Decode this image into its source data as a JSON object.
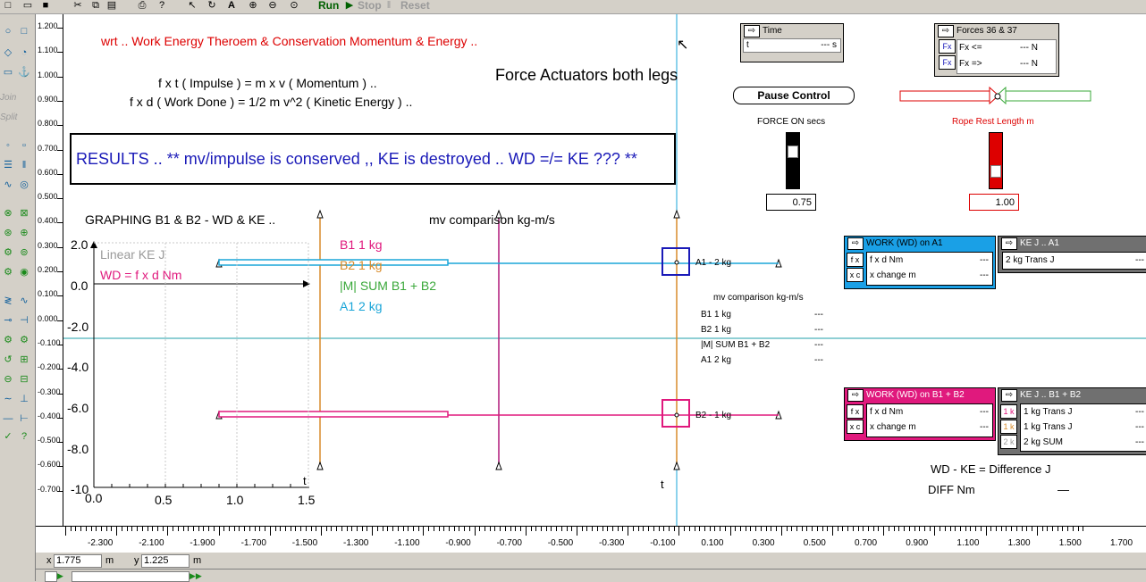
{
  "toolbar": {
    "run": "Run",
    "stop": "Stop",
    "reset": "Reset"
  },
  "palette": {
    "join": "Join",
    "split": "Split"
  },
  "yruler": [
    "1.200",
    "1.100",
    "1.000",
    "0.900",
    "0.800",
    "0.700",
    "0.600",
    "0.500",
    "0.400",
    "0.300",
    "0.200",
    "0.100",
    "0.000",
    "-0.100",
    "-0.200",
    "-0.300",
    "-0.400",
    "-0.500",
    "-0.600",
    "-0.700"
  ],
  "xruler": [
    "-2.300",
    "-2.100",
    "-1.900",
    "-1.700",
    "-1.500",
    "-1.300",
    "-1.100",
    "-0.900",
    "-0.700",
    "-0.500",
    "-0.300",
    "-0.100",
    "0.100",
    "0.300",
    "0.500",
    "0.700",
    "0.900",
    "1.100",
    "1.300",
    "1.500",
    "1.700"
  ],
  "text": {
    "wrt": "wrt .. Work Energy Theroem & Conservation Momentum & Energy ..",
    "impulse": "f x t  ( Impulse )  =  m x v  ( Momentum )  ..",
    "workdone": "f x d  ( Work Done )  =  1/2 m v^2  ( Kinetic Energy )  ..",
    "title": "Force Actuators both legs",
    "results": "RESULTS .. ** mv/impulse is conserved ,, KE is destroyed .. WD =/= KE ??? **",
    "graphing": "GRAPHING B1 & B2 - WD & KE ..",
    "mv_comparison": "mv comparison kg-m/s",
    "t1": "t",
    "t2": "t",
    "a1_label": "A1 - 2 kg",
    "b2_label": "B2 - 1 kg",
    "wd_ke": "WD - KE  =  Difference  J",
    "diff": "DIFF Nm",
    "diff_value": "—"
  },
  "graph": {
    "y_ticks": [
      "2.0",
      "0.0",
      "-2.0",
      "-4.0",
      "-6.0",
      "-8.0",
      "-10"
    ],
    "x_ticks": [
      "0.0",
      "0.5",
      "1.0",
      "1.5"
    ],
    "legend_ke": "Linear KE J",
    "legend_wd": "WD = f x d Nm"
  },
  "legend": {
    "b1": "B1 1 kg",
    "b2": "B2 1 kg",
    "sum": "|M| SUM B1 + B2",
    "a1": "A1 2 kg"
  },
  "mvtable": {
    "title": "mv comparison kg-m/s",
    "rows": [
      {
        "label": "B1 1 kg",
        "value": "---"
      },
      {
        "label": "B2 1 kg",
        "value": "---"
      },
      {
        "label": "|M| SUM B1 + B2",
        "value": "---"
      },
      {
        "label": "A1 2 kg",
        "value": "---"
      }
    ]
  },
  "time_panel": {
    "title": "Time",
    "label": "t",
    "value": "--- s"
  },
  "forces_panel": {
    "title": "Forces 36 & 37",
    "rows": [
      {
        "btn": "Fx",
        "label": "Fx <=",
        "value": "--- N"
      },
      {
        "btn": "Fx",
        "label": "Fx =>",
        "value": "--- N"
      }
    ]
  },
  "pause_button": "Pause Control",
  "force_on": {
    "label": "FORCE ON secs",
    "value": "0.75"
  },
  "rope_rest": {
    "label": "Rope Rest Length m",
    "value": "1.00"
  },
  "wd_a1": {
    "title": "WORK (WD) on A1",
    "rows": [
      {
        "btn": "f x",
        "label": "f x d Nm",
        "value": "---"
      },
      {
        "btn": "x c",
        "label": "x change m",
        "value": "---"
      }
    ]
  },
  "ke_a1": {
    "title": "KE J .. A1",
    "rows": [
      {
        "label": "2 kg Trans J",
        "value": "---"
      }
    ]
  },
  "wd_b": {
    "title": "WORK (WD) on B1 + B2",
    "rows": [
      {
        "btn": "f x",
        "label": "f x d Nm",
        "value": "---"
      },
      {
        "btn": "x c",
        "label": "x change m",
        "value": "---"
      }
    ]
  },
  "ke_b": {
    "title": "KE J .. B1 + B2",
    "rows": [
      {
        "btn": "1 k",
        "label": "1 kg Trans J",
        "value": "---"
      },
      {
        "btn": "1 k",
        "label": "1 kg Trans J",
        "value": "---"
      },
      {
        "btn": "2 k",
        "label": "2 kg SUM",
        "value": "---"
      }
    ]
  },
  "status": {
    "x_label": "x",
    "x_value": "1.775",
    "x_unit": "m",
    "y_label": "y",
    "y_value": "1.225",
    "y_unit": "m"
  },
  "colors": {
    "red": "#dd0000",
    "blue": "#1a1ab8",
    "magenta": "#e0197d",
    "orange": "#d98c2b",
    "cyan": "#1aa5d8",
    "green": "#3aa83a",
    "teal": "#1f9fa8",
    "panel_blue": "#1aa0e6",
    "panel_gray": "#707070"
  }
}
